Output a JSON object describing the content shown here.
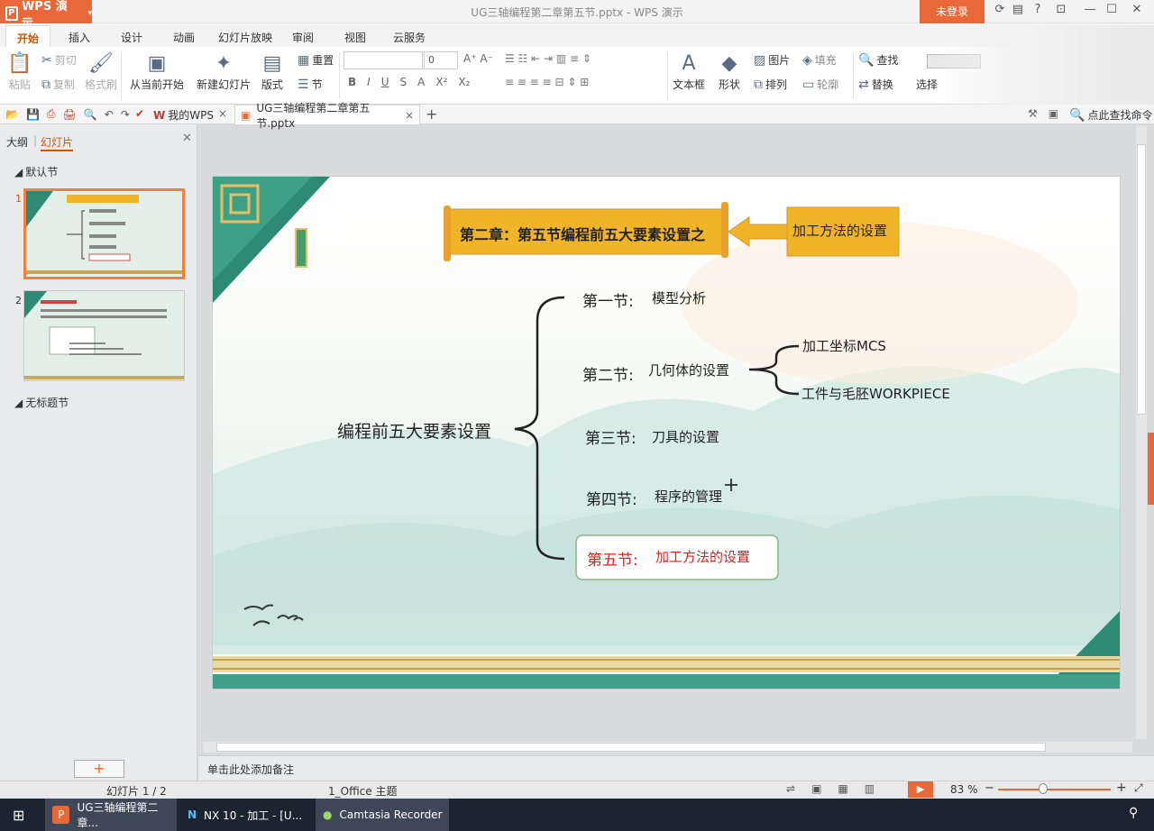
{
  "app": {
    "name": "WPS 演示",
    "doc_title": "UG三轴编程第二章第五节.pptx - WPS 演示",
    "login": "未登录"
  },
  "ribbon_tabs": [
    "开始",
    "插入",
    "设计",
    "动画",
    "幻灯片放映",
    "审阅",
    "视图",
    "云服务"
  ],
  "ribbon": {
    "paste": "粘贴",
    "cut": "剪切",
    "copy": "复制",
    "format_painter": "格式刷",
    "play_from_current": "从当前开始",
    "new_slide": "新建幻灯片",
    "layout": "版式",
    "reset": "重置",
    "section": "节",
    "font_size": "0",
    "textbox": "文本框",
    "shape": "形状",
    "picture": "图片",
    "fill": "填充",
    "arrange": "排列",
    "outline": "轮廓",
    "find": "查找",
    "replace": "替换",
    "select": "选择"
  },
  "quickbar": {
    "my_wps": "我的WPS",
    "doc_tab": "UG三轴编程第二章第五节.pptx",
    "search_cmd": "点此查找命令"
  },
  "left_panel": {
    "tab_outline": "大纲",
    "tab_slides": "幻灯片",
    "section_default": "默认节",
    "section_untitled": "无标题节",
    "slide_nums": [
      "1",
      "2"
    ]
  },
  "slide": {
    "banner": "第二章：第五节编程前五大要素设置之",
    "callout": "加工方法的设置",
    "root": "编程前五大要素设置",
    "sections": [
      {
        "num": "第一节:",
        "text": "模型分析"
      },
      {
        "num": "第二节:",
        "text": "几何体的设置"
      },
      {
        "num": "第三节:",
        "text": "刀具的设置"
      },
      {
        "num": "第四节:",
        "text": "程序的管理"
      },
      {
        "num": "第五节:",
        "text": "加工方法的设置"
      }
    ],
    "sub_items": [
      "加工坐标MCS",
      "工件与毛胚WORKPIECE"
    ],
    "highlight_color": "#e0201a"
  },
  "notes_placeholder": "单击此处添加备注",
  "status": {
    "slide_count": "幻灯片 1 / 2",
    "theme": "1_Office 主题",
    "zoom": "83 %"
  },
  "taskbar": [
    "UG三轴编程第二章...",
    "NX 10 - 加工 - [U...",
    "Camtasia Recorder"
  ]
}
